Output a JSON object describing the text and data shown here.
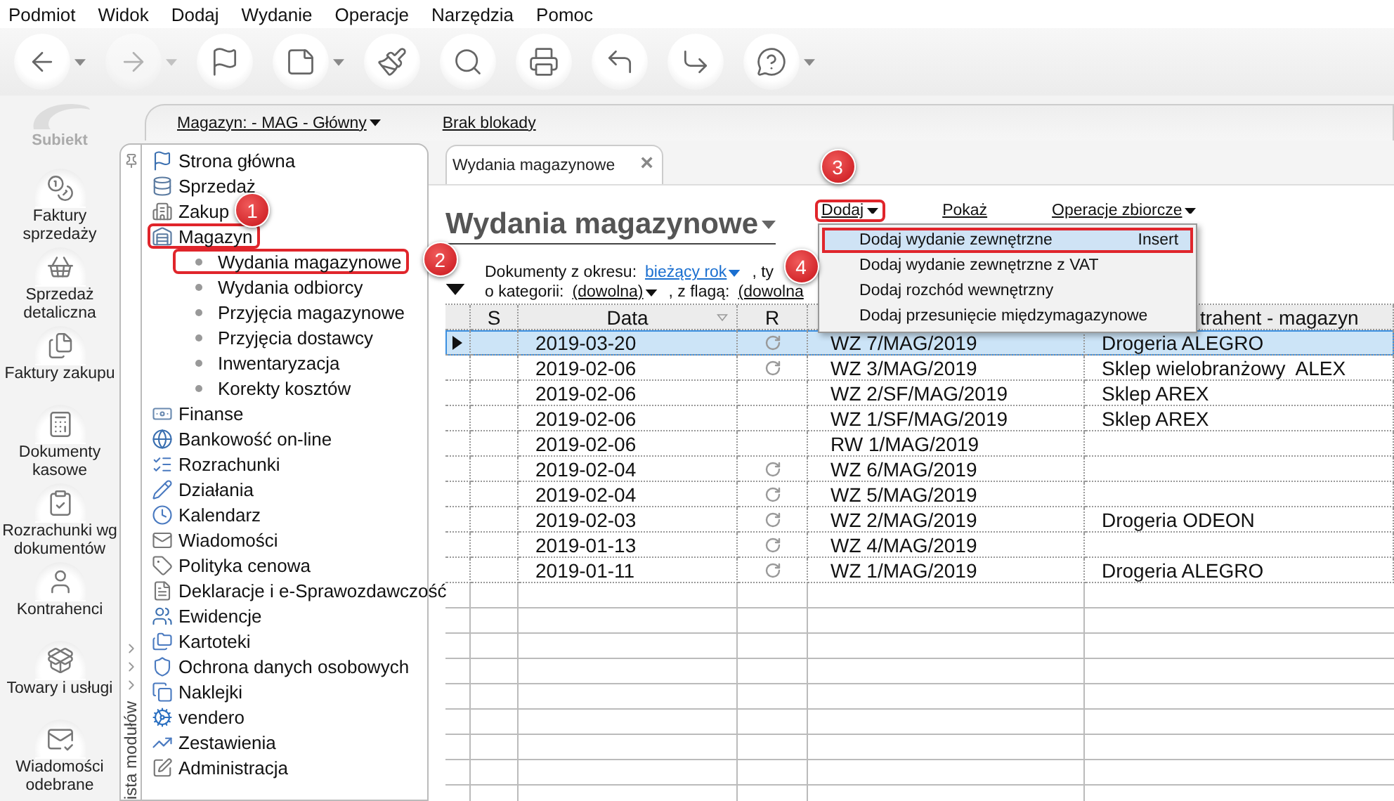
{
  "menu_bar": [
    "Podmiot",
    "Widok",
    "Dodaj",
    "Wydanie",
    "Operacje",
    "Narzędzia",
    "Pomoc"
  ],
  "toolbar": [
    {
      "kind": "back",
      "dropdown": true,
      "disabled": false
    },
    {
      "kind": "forward",
      "dropdown": true,
      "disabled": true
    },
    {
      "kind": "flag",
      "dropdown": false,
      "disabled": false
    },
    {
      "kind": "page",
      "dropdown": true,
      "disabled": false
    },
    {
      "kind": "brush",
      "dropdown": false,
      "disabled": false
    },
    {
      "kind": "search",
      "dropdown": false,
      "disabled": false
    },
    {
      "kind": "printer",
      "dropdown": false,
      "disabled": false
    },
    {
      "kind": "return",
      "dropdown": false,
      "disabled": false
    },
    {
      "kind": "export",
      "dropdown": false,
      "disabled": false
    },
    {
      "kind": "help",
      "dropdown": true,
      "disabled": false
    }
  ],
  "app_name": "Subiekt",
  "modules": [
    {
      "label": "Faktury sprzedaży",
      "kind": "coins"
    },
    {
      "label": "Sprzedaż detaliczna",
      "kind": "basket"
    },
    {
      "label": "Faktury zakupu",
      "kind": "files"
    },
    {
      "label": "Dokumenty kasowe",
      "kind": "register"
    },
    {
      "label": "Rozrachunki wg dokumentów",
      "kind": "check"
    },
    {
      "label": "Kontrahenci",
      "kind": "person"
    },
    {
      "label": "Towary i usługi",
      "kind": "package"
    },
    {
      "label": "Wiadomości odebrane",
      "kind": "mail"
    }
  ],
  "location_bar": {
    "warehouse": "Magazyn: - MAG - Główny",
    "lock": "Brak blokady"
  },
  "module_list_label": "ista modułów",
  "nav": [
    {
      "label": "Strona główna",
      "kind": "flag"
    },
    {
      "label": "Sprzedaż",
      "kind": "database"
    },
    {
      "label": "Zakup",
      "kind": "building"
    },
    {
      "label": "Magazyn",
      "kind": "warehouse",
      "expanded": true,
      "marked": true,
      "badge": "1",
      "children": [
        {
          "label": "Wydania magazynowe",
          "marked": true,
          "badge": "2"
        },
        {
          "label": "Wydania odbiorcy"
        },
        {
          "label": "Przyjęcia magazynowe"
        },
        {
          "label": "Przyjęcia dostawcy"
        },
        {
          "label": "Inwentaryzacja"
        },
        {
          "label": "Korekty kosztów"
        }
      ]
    },
    {
      "label": "Finanse",
      "kind": "banknote"
    },
    {
      "label": "Bankowość on-line",
      "kind": "globe"
    },
    {
      "label": "Rozrachunki",
      "kind": "checks"
    },
    {
      "label": "Działania",
      "kind": "pencil"
    },
    {
      "label": "Kalendarz",
      "kind": "clock"
    },
    {
      "label": "Wiadomości",
      "kind": "mail"
    },
    {
      "label": "Polityka cenowa",
      "kind": "tag"
    },
    {
      "label": "Deklaracje i e-Sprawozdawczość",
      "kind": "document"
    },
    {
      "label": "Ewidencje",
      "kind": "users"
    },
    {
      "label": "Kartoteki",
      "kind": "folders"
    },
    {
      "label": "Ochrona danych osobowych",
      "kind": "shield"
    },
    {
      "label": "Naklejki",
      "kind": "copy"
    },
    {
      "label": "vendero",
      "kind": "cog"
    },
    {
      "label": "Zestawienia",
      "kind": "chart"
    },
    {
      "label": "Administracja",
      "kind": "edit"
    }
  ],
  "tab": {
    "label": "Wydania magazynowe",
    "close": "×"
  },
  "title": "Wydania magazynowe",
  "actions": [
    {
      "label": "Dodaj",
      "dropdown": true,
      "marked": true,
      "badge": "3",
      "menu": [
        {
          "label": "Dodaj wydanie zewnętrzne",
          "shortcut": "Insert",
          "selected": true,
          "marked": true,
          "badge": "4"
        },
        {
          "label": "Dodaj wydanie zewnętrzne z VAT",
          "selected": false
        },
        {
          "label": "Dodaj rozchód wewnętrzny",
          "selected": false
        },
        {
          "label": "Dodaj przesunięcie międzymagazynowe",
          "selected": false
        }
      ]
    },
    {
      "label": "Pokaż",
      "dropdown": false
    },
    {
      "label": "Operacje zbiorcze",
      "dropdown": true
    }
  ],
  "filters": [
    [
      {
        "kind": "label",
        "text": "Dokumenty z okresu:"
      },
      {
        "kind": "link",
        "text": "bieżący rok",
        "dropdown": true
      },
      {
        "kind": "label",
        "text": ", ty"
      }
    ],
    [
      {
        "kind": "label",
        "text": "o kategorii:"
      },
      {
        "kind": "select",
        "text": "(dowolna)",
        "dropdown": true
      },
      {
        "kind": "label",
        "text": ", z flagą:"
      },
      {
        "kind": "select",
        "text": "(dowolna",
        "dropdown": false
      }
    ]
  ],
  "table": {
    "columns": {
      "s": "S",
      "date": "Data",
      "r": "R",
      "contractor": "trahent - magazyn"
    },
    "rows": [
      {
        "selected": true,
        "date": "2019-03-20",
        "r": true,
        "number": "WZ 7/MAG/2019",
        "contractor": "Drogeria ALEGRO"
      },
      {
        "selected": false,
        "date": "2019-02-06",
        "r": true,
        "number": "WZ 3/MAG/2019",
        "contractor": "Sklep wielobranżowy  ALEX"
      },
      {
        "selected": false,
        "date": "2019-02-06",
        "r": false,
        "number": "WZ 2/SF/MAG/2019",
        "contractor": "Sklep AREX"
      },
      {
        "selected": false,
        "date": "2019-02-06",
        "r": false,
        "number": "WZ 1/SF/MAG/2019",
        "contractor": "Sklep AREX"
      },
      {
        "selected": false,
        "date": "2019-02-06",
        "r": false,
        "number": "RW 1/MAG/2019"
      },
      {
        "selected": false,
        "date": "2019-02-04",
        "r": true,
        "number": "WZ 6/MAG/2019"
      },
      {
        "selected": false,
        "date": "2019-02-04",
        "r": true,
        "number": "WZ 5/MAG/2019"
      },
      {
        "selected": false,
        "date": "2019-02-03",
        "r": true,
        "number": "WZ 2/MAG/2019",
        "contractor": "Drogeria ODEON"
      },
      {
        "selected": false,
        "date": "2019-01-13",
        "r": true,
        "number": "WZ 4/MAG/2019"
      },
      {
        "selected": false,
        "date": "2019-01-11",
        "r": true,
        "number": "WZ 1/MAG/2019",
        "contractor": "Drogeria ALEGRO"
      }
    ]
  }
}
